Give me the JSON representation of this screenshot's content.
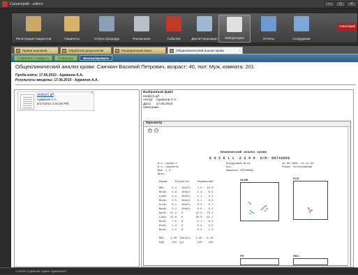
{
  "window": {
    "title": "Санаторий - admin"
  },
  "ribbon": {
    "items": [
      {
        "label": "Регистрация пациентов",
        "icon": "registration-icon",
        "color": "#c9a96a"
      },
      {
        "label": "Пациенты",
        "icon": "patients-icon",
        "color": "#d6b26a"
      },
      {
        "label": "Отпуск процедур",
        "icon": "procedures-icon",
        "color": "#8aa0b8"
      },
      {
        "label": "Расписание",
        "icon": "calendar-icon",
        "color": "#b8c0c8"
      },
      {
        "label": "События",
        "icon": "events-icon",
        "color": "#c0392b"
      },
      {
        "label": "Диспетчеризация",
        "icon": "dispatch-icon",
        "color": "#9fb7cf"
      },
      {
        "label": "Лаборатория",
        "icon": "laboratory-icon",
        "color": "#e0e0e0"
      },
      {
        "label": "Отчеты",
        "icon": "reports-icon",
        "color": "#6f9ad0"
      },
      {
        "label": "Сотрудники",
        "icon": "staff-icon",
        "color": "#7aa6d8"
      }
    ],
    "active": "Лаборатория",
    "exit_label": "Санаторий"
  },
  "tabs": [
    {
      "label": "Прием анализов"
    },
    {
      "label": "Обработка результатов"
    },
    {
      "label": "Расширенный поиск"
    },
    {
      "label": "Общеклинический анализ крови"
    }
  ],
  "toolbar": {
    "buttons": [
      "Сохранить и закрыть",
      "Сохранить",
      "Экспортировать"
    ]
  },
  "page": {
    "title": "Общеклинический анализ крови: Санчкин Василий Петрович, возраст: 40, пол: Муж, комната: 201",
    "sample_line": "Проба взята: 17.06.2010 - Админов А.А.",
    "results_line": "Результаты введены: 17.06.2010 - Админов А.А."
  },
  "file": {
    "name": "analyz1.gif",
    "author": "Админов А.А.",
    "date": "8/17/2010 2:04:06 PM"
  },
  "selected": {
    "header": "Выбранный файл",
    "name": "analyz1.gif",
    "author_label": "Автор:",
    "author": "Админов А.А.",
    "date_label": "Дата:",
    "date": "17.06.2010",
    "desc_label": "Описание:"
  },
  "preview": {
    "header": "Просмотр",
    "doc_title": "Клинический анализ крови",
    "doc_device": "E X C E L L  2 2 8 0  S/N: 60742082",
    "doc_meta_left": [
      "И.н. пробы:1",
      "И.н. пациента",
      "Имя: 1 П",
      "Врач:"
    ],
    "doc_meta_mid": [
      "Порядковый №:18",
      "Пол:",
      "Фамилия: МУСИНОВА"
    ],
    "doc_meta_right": [
      "10.06.2009  11:11:00",
      "Режим: Эксклюзивный"
    ],
    "table_header": "Парам.    Результат     Нормальный",
    "rows": [
      "WBC:    6.4   10e9/L    4.0 - 10.0",
      "NeuW:   5.6   10e9/L    1.4 -  6.5",
      "LymW:   2.1   10e9/L    1.2 -  3.4",
      "MonW:   0.5   10e9/L    0.1 -  0.6",
      "EosN:   0.1   10e9/L    0.0 -  0.7",
      "BasN:   0.1   10e9/L    0.0 -  0.1",
      "Neu%:  57.4   %        42.0 - 75.2",
      "Lym%:  32.8   %        20.0 - 51.1",
      "Mon%:   7.5   %         1.7 -  9.3",
      "Eos%:   1.2   %         0.0 -  3.0",
      "Bas%:   1.1   %         0.0 -  1.0",
      "",
      "RBC:   4.60  10e12/L   4.20 - 6.10",
      "HgB:    142  g/L        120 -  180"
    ],
    "graph_labels": [
      "NLMB",
      "EOS",
      "PR",
      "RBC"
    ]
  },
  "statusbar": {
    "text": "A.admin (Админов Админ Админович)"
  }
}
